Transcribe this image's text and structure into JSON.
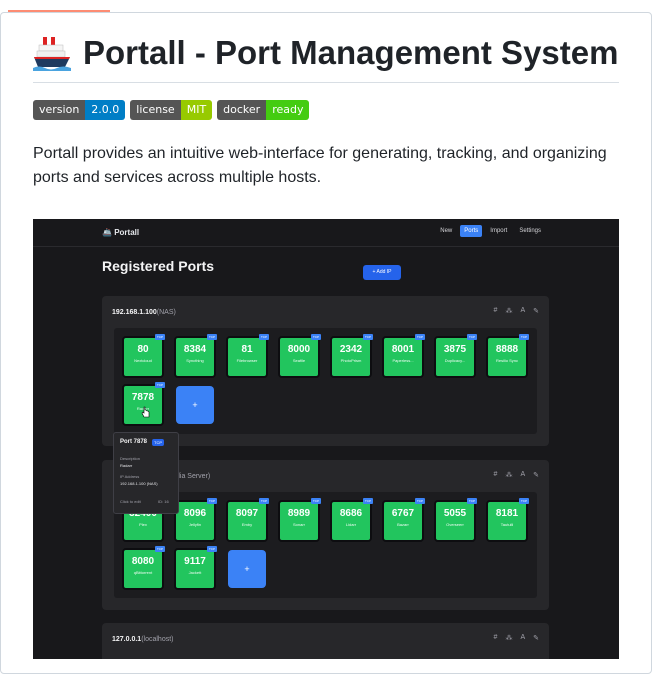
{
  "readme": {
    "title": "Portall - Port Management System",
    "badges": [
      {
        "label": "version",
        "value": "2.0.0",
        "color": "#007ec6"
      },
      {
        "label": "license",
        "value": "MIT",
        "color": "#97ca00"
      },
      {
        "label": "docker",
        "value": "ready",
        "color": "#4c1"
      }
    ],
    "description": "Portall provides an intuitive web-interface for generating, tracking, and organizing ports and services across multiple hosts."
  },
  "app": {
    "brand": "Portall",
    "nav": [
      "New",
      "Ports",
      "Import",
      "Settings"
    ],
    "active_nav": "Ports",
    "page_title": "Registered Ports",
    "add_ip_label": "+ Add IP",
    "hosts": [
      {
        "ip": "192.168.1.100",
        "nickname": "(NAS)",
        "ports": [
          {
            "port": "80",
            "service": "Nextcloud"
          },
          {
            "port": "8384",
            "service": "Syncthing"
          },
          {
            "port": "81",
            "service": "Filebrowser"
          },
          {
            "port": "8000",
            "service": "Seafile"
          },
          {
            "port": "2342",
            "service": "PhotoPrism"
          },
          {
            "port": "8001",
            "service": "Paperless..."
          },
          {
            "port": "3875",
            "service": "Duplicacy..."
          },
          {
            "port": "8888",
            "service": "Resilio Sync"
          },
          {
            "port": "7878",
            "service": "Radarr"
          }
        ]
      },
      {
        "ip": "",
        "nickname": "dia Server)",
        "ports": [
          {
            "port": "32400",
            "service": "Plex"
          },
          {
            "port": "8096",
            "service": "Jellyfin"
          },
          {
            "port": "8097",
            "service": "Emby"
          },
          {
            "port": "8989",
            "service": "Sonarr"
          },
          {
            "port": "8686",
            "service": "Lidarr"
          },
          {
            "port": "6767",
            "service": "Bazarr"
          },
          {
            "port": "5055",
            "service": "Overseerr"
          },
          {
            "port": "8181",
            "service": "Tautulli"
          },
          {
            "port": "8080",
            "service": "qBittorrent"
          },
          {
            "port": "9117",
            "service": "Jackett"
          }
        ]
      },
      {
        "ip": "127.0.0.1",
        "nickname": "(localhost)",
        "ports": []
      }
    ],
    "tcp_label": "TCP",
    "add_port_label": "+",
    "host_icons": [
      "#",
      "⁂",
      "A",
      "✎"
    ],
    "popup": {
      "title": "Port 7878",
      "protocol": "TCP",
      "desc_label": "Description",
      "desc_value": "Radarr",
      "ip_label": "IP Address",
      "ip_value": "192.168.1.100 (NAS)",
      "footer_left": "Click to edit",
      "footer_right": "ID: 16"
    }
  }
}
